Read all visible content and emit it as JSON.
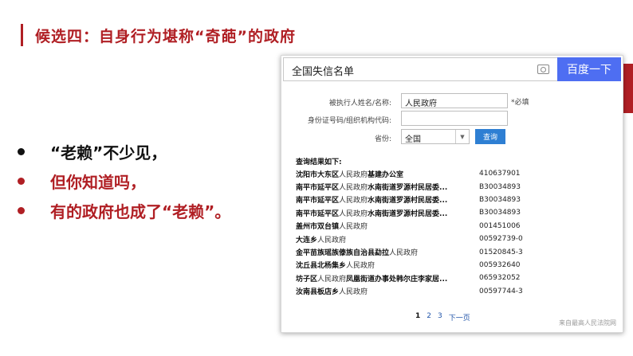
{
  "slide": {
    "title": "候选四：自身行为堪称“奇葩”的政府",
    "accent_color": "#b01f24",
    "bullets": [
      {
        "text": "“老赖”不少见，",
        "color": "#111111"
      },
      {
        "text": "但你知道吗，",
        "color": "#b01f24"
      },
      {
        "text": "有的政府也成了“老赖”。",
        "color": "#b01f24"
      }
    ]
  },
  "browser": {
    "search_query": "全国失信名单",
    "search_button": "百度一下",
    "camera_icon": "camera-icon"
  },
  "form": {
    "name_label": "被执行人姓名/名称:",
    "name_value": "人民政府",
    "required_note": "*必填",
    "id_label": "身份证号码/组织机构代码:",
    "id_value": "",
    "province_label": "省份:",
    "province_value": "全国",
    "query_button": "查询"
  },
  "results": {
    "heading": "查询结果如下:",
    "rows": [
      {
        "pre": "沈阳市大东区",
        "hl": "人民政府",
        "post": "基建办公室",
        "code": "410637901"
      },
      {
        "pre": "南平市延平区",
        "hl": "人民政府",
        "post": "水南街道罗源村民居委...",
        "code": "B30034893"
      },
      {
        "pre": "南平市延平区",
        "hl": "人民政府",
        "post": "水南街道罗源村民居委...",
        "code": "B30034893"
      },
      {
        "pre": "南平市延平区",
        "hl": "人民政府",
        "post": "水南街道罗源村民居委...",
        "code": "B30034893"
      },
      {
        "pre": "盖州市双台镇",
        "hl": "人民政府",
        "post": "",
        "code": "001451006"
      },
      {
        "pre": "大连乡",
        "hl": "人民政府",
        "post": "",
        "code": "00592739-0"
      },
      {
        "pre": "金平苗族瑶族傣族自治县勐拉",
        "hl": "人民政府",
        "post": "",
        "code": "01520845-3"
      },
      {
        "pre": "沈丘县北杨集乡",
        "hl": "人民政府",
        "post": "",
        "code": "005932640"
      },
      {
        "pre": "坊子区",
        "hl": "人民政府",
        "post": "凤凰街道办事处韩尔庄李家居...",
        "code": "065932052"
      },
      {
        "pre": "汝南县板店乡",
        "hl": "人民政府",
        "post": "",
        "code": "00597744-3"
      }
    ],
    "pager": {
      "current": "1",
      "p2": "2",
      "p3": "3",
      "next": "下一页"
    },
    "source": "来自最高人民法院网"
  }
}
